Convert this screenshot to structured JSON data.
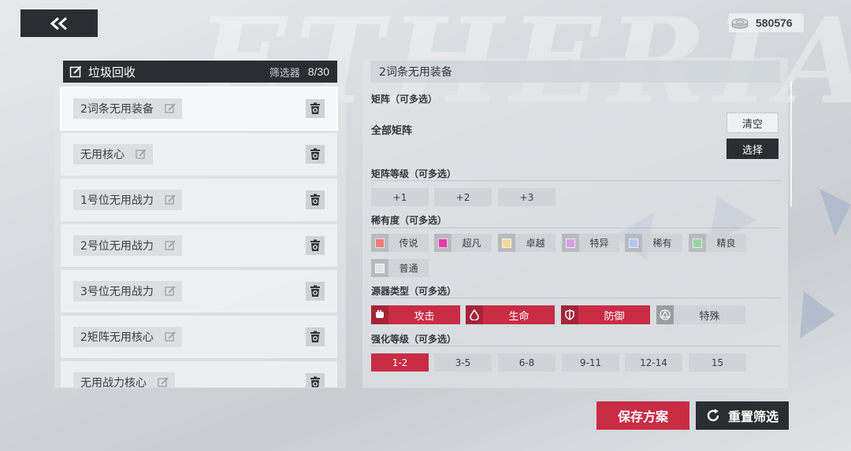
{
  "currency": {
    "amount": "580576",
    "icon": "coin-stack-icon"
  },
  "background_word": "ETHERIA",
  "left_panel": {
    "title": "垃圾回收",
    "filter_label": "筛选器",
    "count": "8/30",
    "items": [
      {
        "name": "2词条无用装备"
      },
      {
        "name": "无用核心"
      },
      {
        "name": "1号位无用战力"
      },
      {
        "name": "2号位无用战力"
      },
      {
        "name": "3号位无用战力"
      },
      {
        "name": "2矩阵无用核心"
      },
      {
        "name": "无用战力核心"
      }
    ]
  },
  "right_panel": {
    "title": "2词条无用装备",
    "matrix_label": "矩阵（可多选）",
    "matrix_value": "全部矩阵",
    "clear_button": "清空",
    "select_button": "选择",
    "matrix_level_label": "矩阵等级（可多选）",
    "matrix_levels": [
      "+1",
      "+2",
      "+3"
    ],
    "rarity_label": "稀有度（可多选）",
    "rarities": [
      {
        "label": "传说",
        "color": "#f07a7a"
      },
      {
        "label": "超凡",
        "color": "#e83aa6"
      },
      {
        "label": "卓越",
        "color": "#f4d79a"
      },
      {
        "label": "特异",
        "color": "#d69ee6"
      },
      {
        "label": "稀有",
        "color": "#b9c4ef"
      },
      {
        "label": "精良",
        "color": "#98d1a4"
      },
      {
        "label": "普通",
        "color": "#e3e4e5"
      }
    ],
    "source_type_label": "源器类型（可多选）",
    "source_types": [
      {
        "label": "攻击",
        "icon": "fist-icon",
        "active": true
      },
      {
        "label": "生命",
        "icon": "blood-drop-icon",
        "active": true
      },
      {
        "label": "防御",
        "icon": "shield-icon",
        "active": true
      },
      {
        "label": "特殊",
        "icon": "special-triangle-icon",
        "active": false
      }
    ],
    "enhance_label": "强化等级（可多选）",
    "enhance_levels": [
      "1-2",
      "3-5",
      "6-8",
      "9-11",
      "12-14",
      "15"
    ],
    "enhance_active": "1-2"
  },
  "buttons": {
    "save": "保存方案",
    "reset": "重置筛选"
  },
  "colors": {
    "accent": "#c92c45",
    "dark": "#2a2d31"
  }
}
